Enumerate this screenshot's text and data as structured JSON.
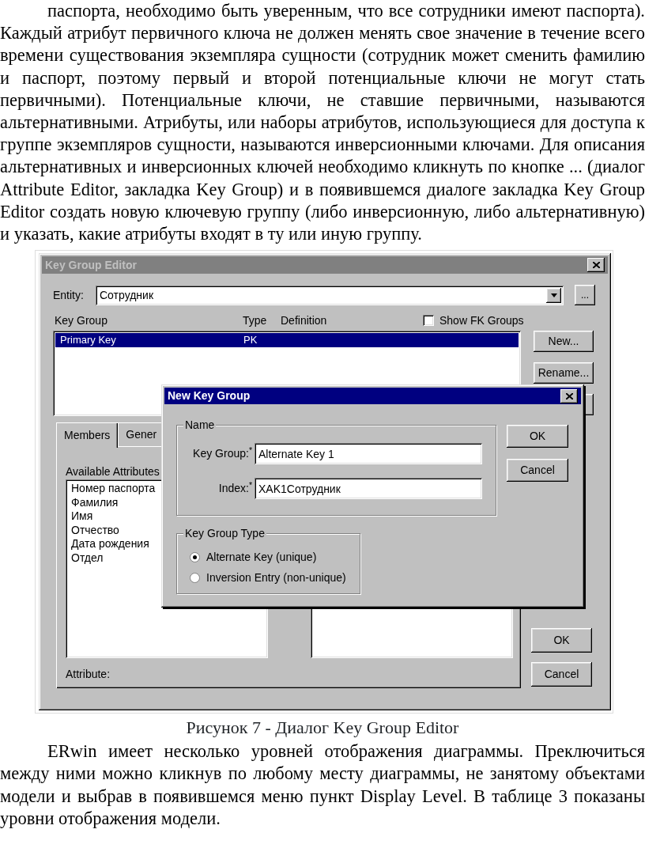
{
  "document": {
    "paragraph_before": "паспорта, необходимо быть уверенным, что все сотрудники имеют паспорта). Каждый атрибут первичного ключа не должен менять свое значение в течение всего времени существования экземпляра сущности (сотрудник может сменить фамилию и паспорт, поэтому первый и второй потенциальные ключи не могут стать первичными). Потенциальные ключи, не ставшие первичными, называются альтернативными. Атрибуты, или наборы атрибутов, использующиеся для доступа к группе экземпляров сущности, называются инверсионными ключами. Для описания альтернативных и инверсионных ключей необходимо кликнуть по кнопке ... (диалог Attribute Editor, закладка Key Group) и в появившемся диалоге закладка Key Group Editor создать новую ключевую группу (либо инверсионную, либо альтернативную) и указать, какие атрибуты входят в ту или иную группу.",
    "figure": {
      "editor_window": {
        "title": "Key Group Editor",
        "active": false,
        "entity": {
          "label": "Entity:",
          "value": "Сотрудник"
        },
        "browse_button": "...",
        "columns": [
          "Key Group",
          "Type",
          "Definition"
        ],
        "show_fk_groups": {
          "label": "Show FK Groups",
          "checked": false
        },
        "key_groups": [
          {
            "name": "Primary Key",
            "type": "PK",
            "selected": true
          }
        ],
        "side_buttons": [
          "New...",
          "Rename..."
        ],
        "tabs": [
          {
            "label": "Members",
            "selected": true
          },
          {
            "label": "Gener",
            "selected": false
          }
        ],
        "available_label": "Available Attributes",
        "available_attributes": [
          "Номер паспорта",
          "Фамилия",
          "Имя",
          "Отчество",
          "Дата рождения",
          "Отдел"
        ],
        "attribute_label": "Attribute:",
        "buttons": [
          "OK",
          "Cancel"
        ]
      },
      "new_key_group_dialog": {
        "title": "New Key Group",
        "active": true,
        "name_group": {
          "legend": "Name",
          "fields": [
            {
              "label": "Key Group:$^{*}$",
              "value": "Alternate Key 1"
            },
            {
              "label": "Index:$^{*}$",
              "value": "XAK1Сотрудник"
            }
          ]
        },
        "type_group": {
          "legend": "Key Group Type",
          "options": [
            {
              "label": "Alternate Key (unique)",
              "selected": true
            },
            {
              "label": "Inversion Entry (non-unique)",
              "selected": false
            }
          ]
        },
        "buttons": [
          "OK",
          "Cancel"
        ]
      }
    },
    "caption": "Рисунок 7 - Диалог Key Group Editor",
    "paragraph_after": "ERwin имеет несколько уровней отображения диаграммы. Преключиться между ними можно кликнув по любому месту диаграммы, не занятому объектами модели и выбрав в появившемся меню пункт Display Level. В таблице 3 показаны уровни отображения модели."
  }
}
